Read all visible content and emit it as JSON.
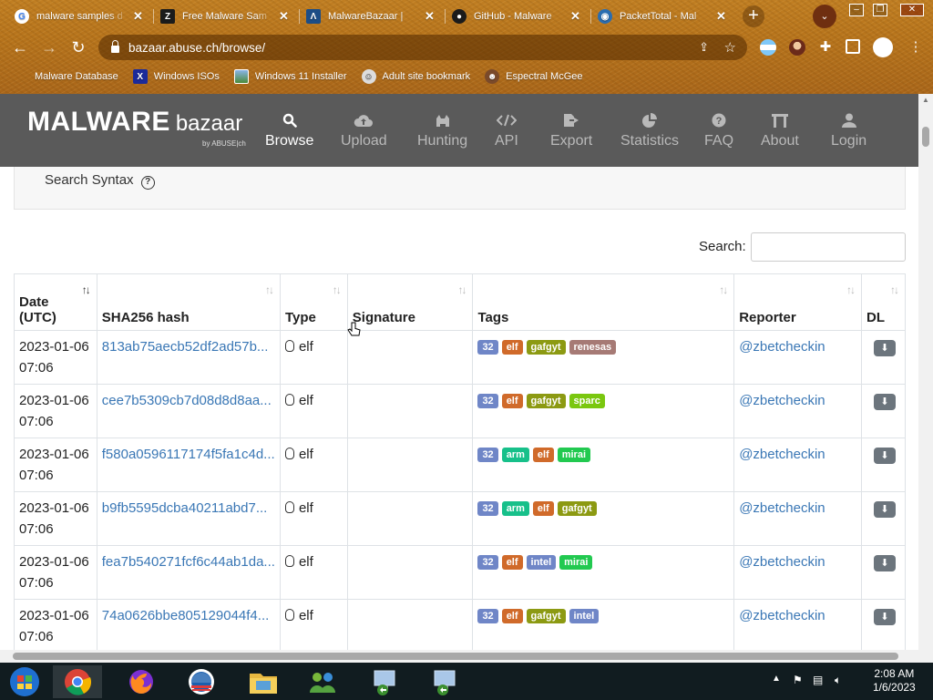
{
  "browser": {
    "tabs": [
      {
        "title": "malware samples d",
        "icon": "google-icon",
        "color": "#ffffff"
      },
      {
        "title": "Free Malware Sam",
        "icon": "zip-icon",
        "color": "#1b1b1b"
      },
      {
        "title": "MalwareBazaar | ",
        "icon": "bazaar-icon",
        "color": "#1c4d86",
        "active": true
      },
      {
        "title": "GitHub - Malware",
        "icon": "github-icon",
        "color": "#1b1b1b"
      },
      {
        "title": "PacketTotal - Mal",
        "icon": "packettotal-icon",
        "color": "#2a6db0"
      }
    ],
    "url": "bazaar.abuse.ch/browse/",
    "bookmarks": [
      {
        "label": "Malware Database",
        "icon": "malware-db-icon"
      },
      {
        "label": "Windows ISOs",
        "icon": "x-icon"
      },
      {
        "label": "Windows 11 Installer",
        "icon": "image-icon"
      },
      {
        "label": "Adult site bookmark",
        "icon": "bookmark-face-icon"
      },
      {
        "label": "Espectral McGee",
        "icon": "person-icon"
      }
    ]
  },
  "site": {
    "logo_main": "MALWARE",
    "logo_sub": "bazaar",
    "logo_by": "by ABUSE|ch",
    "nav": [
      {
        "label": "Browse",
        "icon": "search-icon",
        "active": true
      },
      {
        "label": "Upload",
        "icon": "upload-cloud-icon"
      },
      {
        "label": "Hunting",
        "icon": "cat-icon"
      },
      {
        "label": "API",
        "icon": "code-icon"
      },
      {
        "label": "Export",
        "icon": "export-icon"
      },
      {
        "label": "Statistics",
        "icon": "pie-chart-icon"
      },
      {
        "label": "FAQ",
        "icon": "question-icon"
      },
      {
        "label": "About",
        "icon": "building-icon"
      },
      {
        "label": "Login",
        "icon": "user-icon"
      }
    ],
    "search_syntax_label": "Search Syntax",
    "search_label": "Search:",
    "search_value": ""
  },
  "table": {
    "headers": {
      "date": [
        "Date",
        "(UTC)"
      ],
      "hash": "SHA256 hash",
      "type": "Type",
      "signature": "Signature",
      "tags": "Tags",
      "reporter": "Reporter",
      "dl": "DL"
    },
    "tag_colors": {
      "32": "#6f86c7",
      "elf": "#d06a2a",
      "gafgyt": "#8c9a12",
      "renesas": "#a67a75",
      "sparc": "#7ac70f",
      "arm": "#17c08a",
      "mirai": "#22c950",
      "intel": "#6f86c7"
    },
    "rows": [
      {
        "date": "2023-01-06",
        "time": "07:06",
        "hash": "813ab75aecb52df2ad57b...",
        "type": "elf",
        "signature": "",
        "tags": [
          "32",
          "elf",
          "gafgyt",
          "renesas"
        ],
        "reporter": "@zbetcheckin"
      },
      {
        "date": "2023-01-06",
        "time": "07:06",
        "hash": "cee7b5309cb7d08d8d8aa...",
        "type": "elf",
        "signature": "",
        "tags": [
          "32",
          "elf",
          "gafgyt",
          "sparc"
        ],
        "reporter": "@zbetcheckin"
      },
      {
        "date": "2023-01-06",
        "time": "07:06",
        "hash": "f580a0596117174f5fa1c4d...",
        "type": "elf",
        "signature": "",
        "tags": [
          "32",
          "arm",
          "elf",
          "mirai"
        ],
        "reporter": "@zbetcheckin"
      },
      {
        "date": "2023-01-06",
        "time": "07:06",
        "hash": "b9fb5595dcba40211abd7...",
        "type": "elf",
        "signature": "",
        "tags": [
          "32",
          "arm",
          "elf",
          "gafgyt"
        ],
        "reporter": "@zbetcheckin"
      },
      {
        "date": "2023-01-06",
        "time": "07:06",
        "hash": "fea7b540271fcf6c44ab1da...",
        "type": "elf",
        "signature": "",
        "tags": [
          "32",
          "elf",
          "intel",
          "mirai"
        ],
        "reporter": "@zbetcheckin"
      },
      {
        "date": "2023-01-06",
        "time": "07:06",
        "hash": "74a0626bbe805129044f4...",
        "type": "elf",
        "signature": "",
        "tags": [
          "32",
          "elf",
          "gafgyt",
          "intel"
        ],
        "reporter": "@zbetcheckin"
      }
    ]
  },
  "taskbar": {
    "time": "2:08 AM",
    "date": "1/6/2023",
    "apps": [
      "start-icon",
      "chrome-icon",
      "firefox-icon",
      "obama-logo-icon",
      "file-explorer-icon",
      "network-people-icon",
      "computer-arrow-icon",
      "computer-arrow-icon"
    ]
  }
}
